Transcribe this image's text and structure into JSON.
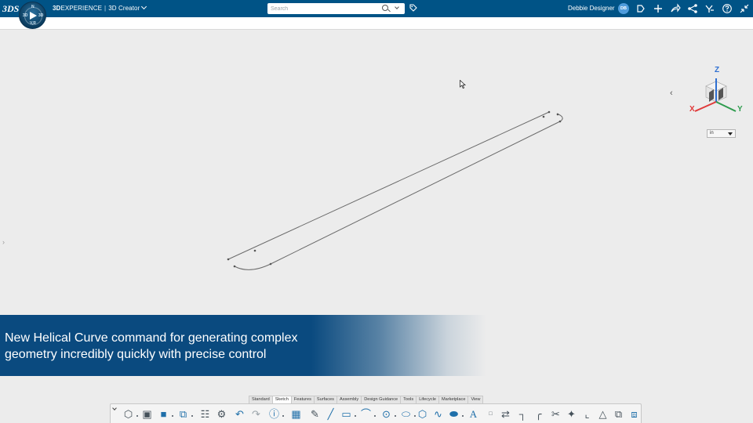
{
  "app": {
    "brand_bold": "3D",
    "brand_rest": "EXPERIENCE",
    "separator": "|",
    "app_name": "3D Creator",
    "compass_quadrants": [
      "3D",
      "V,R",
      "N",
      "3D"
    ],
    "logo_text": "3DS"
  },
  "search": {
    "placeholder": "Search",
    "value": ""
  },
  "user": {
    "name": "Debbie Designer",
    "initials": "DB"
  },
  "top_icons": [
    "add-content-icon",
    "plus-icon",
    "share-icon",
    "share-network-icon",
    "community-icon",
    "help-icon",
    "collapse-fullscreen-icon"
  ],
  "viewport": {
    "unit": "in",
    "axes": {
      "x": "X",
      "y": "Y",
      "z": "Z"
    },
    "colors": {
      "x": "#e03a3a",
      "y": "#2e9c4e",
      "z": "#2e6fd1"
    }
  },
  "caption": {
    "line1": "New Helical Curve command for generating complex",
    "line2": "geometry incredibly quickly with precise control"
  },
  "action_bar": {
    "tabs": [
      "Standard",
      "Sketch",
      "Features",
      "Surfaces",
      "Assembly",
      "Design Guidance",
      "Tools",
      "Lifecycle",
      "Marketplace",
      "View"
    ],
    "active_tab": "Sketch",
    "tools": [
      "view-cube-icon",
      "part-icon",
      "save-icon",
      "sketch-plane-icon",
      "properties-icon",
      "settings-icon",
      "undo-icon",
      "redo-icon",
      "help-icon",
      "grid-icon",
      "pen-icon",
      "line-icon",
      "rectangle-icon",
      "arc-icon",
      "circle-icon",
      "ellipse-icon",
      "polygon-icon",
      "spline-icon",
      "slot-icon",
      "text-icon",
      "point-icon",
      "offset-icon",
      "corner-icon",
      "fillet-icon",
      "trim-icon",
      "project-icon",
      "chamfer-icon",
      "constraint-icon",
      "cube-icon",
      "exit-sketch-icon"
    ]
  },
  "colors": {
    "topbar": "#005386",
    "banner": "#0a4a7f",
    "canvas": "#ececec"
  }
}
